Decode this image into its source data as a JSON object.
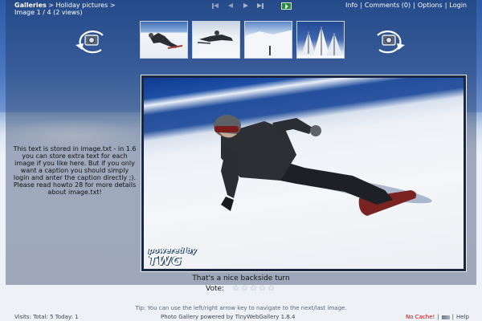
{
  "breadcrumb": {
    "galleries": "Galleries",
    "separator": ">",
    "album": "Holiday pictures",
    "tail": ">",
    "position": "Image 1 / 4 (2 views)"
  },
  "nav": {
    "first_icon": "first-arrow-icon",
    "prev_icon": "previous-arrow-icon",
    "next_icon": "next-arrow-icon",
    "last_icon": "last-arrow-icon",
    "slideshow_icon": "slideshow-icon"
  },
  "toplinks": {
    "info": "Info",
    "comments": "Comments (0)",
    "options": "Options",
    "login": "Login",
    "sep": "|"
  },
  "thumbnails": [
    {
      "name": "thumb-1"
    },
    {
      "name": "thumb-2"
    },
    {
      "name": "thumb-3"
    },
    {
      "name": "thumb-4"
    }
  ],
  "powered": {
    "line1": "powered by",
    "line2": "TWG"
  },
  "side_text": "This text is stored in image.txt - in 1.6 you can store extra text for each image if you like here. But if you only want a caption you should simply login and anter the caption directly ;). Please read howto 28 for more details about image.txt!",
  "caption": "That's a nice backside turn",
  "vote": {
    "label": "Vote:",
    "stars": 5
  },
  "tip": "Tip: You can use the left/right arrow key to navigate to the next/last image.",
  "footer": {
    "visits": "Visits: Total: 5 Today: 1",
    "powered": "Photo Gallery powered by TinyWebGallery 1.8.4",
    "nocache": "No Cache!",
    "sep": "|",
    "help": "Help"
  },
  "colors": {
    "accent_sky": "#2b5aa8",
    "nocache_red": "#e00000"
  }
}
